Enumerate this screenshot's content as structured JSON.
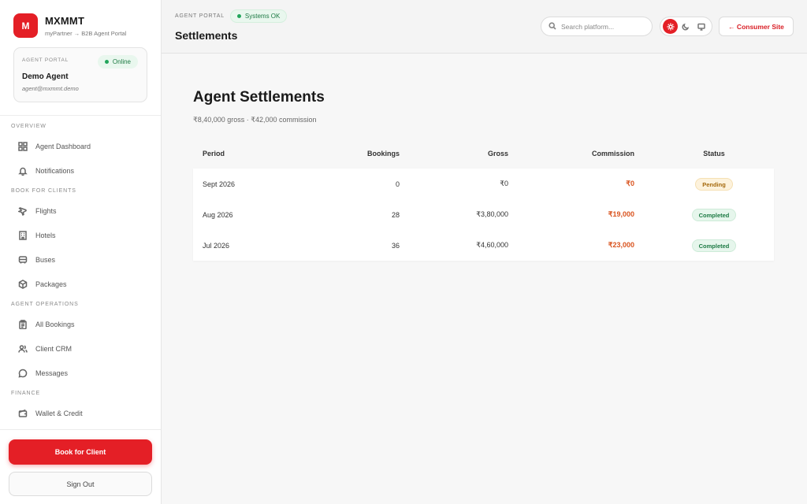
{
  "brand": {
    "logo_letter": "M",
    "name": "MXMMT",
    "subtitle": "myPartner → B2B Agent Portal",
    "accent_color": "#e41f26"
  },
  "agent_card": {
    "label": "AGENT PORTAL",
    "status": "Online",
    "name": "Demo Agent",
    "email": "agent@mxmmt.demo"
  },
  "nav": {
    "sections": [
      {
        "title": "OVERVIEW",
        "items": [
          {
            "label": "Agent Dashboard",
            "icon": "grid-icon"
          },
          {
            "label": "Notifications",
            "icon": "bell-icon"
          }
        ]
      },
      {
        "title": "BOOK FOR CLIENTS",
        "items": [
          {
            "label": "Flights",
            "icon": "plane-icon"
          },
          {
            "label": "Hotels",
            "icon": "building-icon"
          },
          {
            "label": "Buses",
            "icon": "bus-icon"
          },
          {
            "label": "Packages",
            "icon": "package-icon"
          }
        ]
      },
      {
        "title": "AGENT OPERATIONS",
        "items": [
          {
            "label": "All Bookings",
            "icon": "clipboard-icon"
          },
          {
            "label": "Client CRM",
            "icon": "users-icon"
          },
          {
            "label": "Messages",
            "icon": "chat-icon"
          }
        ]
      },
      {
        "title": "FINANCE",
        "items": [
          {
            "label": "Wallet & Credit",
            "icon": "wallet-icon"
          }
        ]
      }
    ]
  },
  "sidebar_actions": {
    "primary": "Book for Client",
    "secondary": "Sign Out"
  },
  "header": {
    "portal_label": "AGENT PORTAL",
    "status": "Systems OK",
    "title": "Settlements",
    "search_placeholder": "Search platform...",
    "theme_options": [
      "light-icon",
      "dark-icon",
      "system-icon"
    ],
    "active_theme": "light-icon",
    "consumer_link": "← Consumer Site"
  },
  "main": {
    "title": "Agent Settlements",
    "subtitle": "₹8,40,000 gross · ₹42,000 commission",
    "columns": [
      "Period",
      "Bookings",
      "Gross",
      "Commission",
      "Status"
    ],
    "rows": [
      {
        "period": "Sept 2026",
        "bookings": "0",
        "gross": "₹0",
        "commission": "₹0",
        "status": "Pending"
      },
      {
        "period": "Aug 2026",
        "bookings": "28",
        "gross": "₹3,80,000",
        "commission": "₹19,000",
        "status": "Completed"
      },
      {
        "period": "Jul 2026",
        "bookings": "36",
        "gross": "₹4,60,000",
        "commission": "₹23,000",
        "status": "Completed"
      }
    ],
    "status_colors": {
      "Pending": "#a5690c",
      "Completed": "#1d7a44"
    },
    "commission_color": "#d9531e"
  }
}
